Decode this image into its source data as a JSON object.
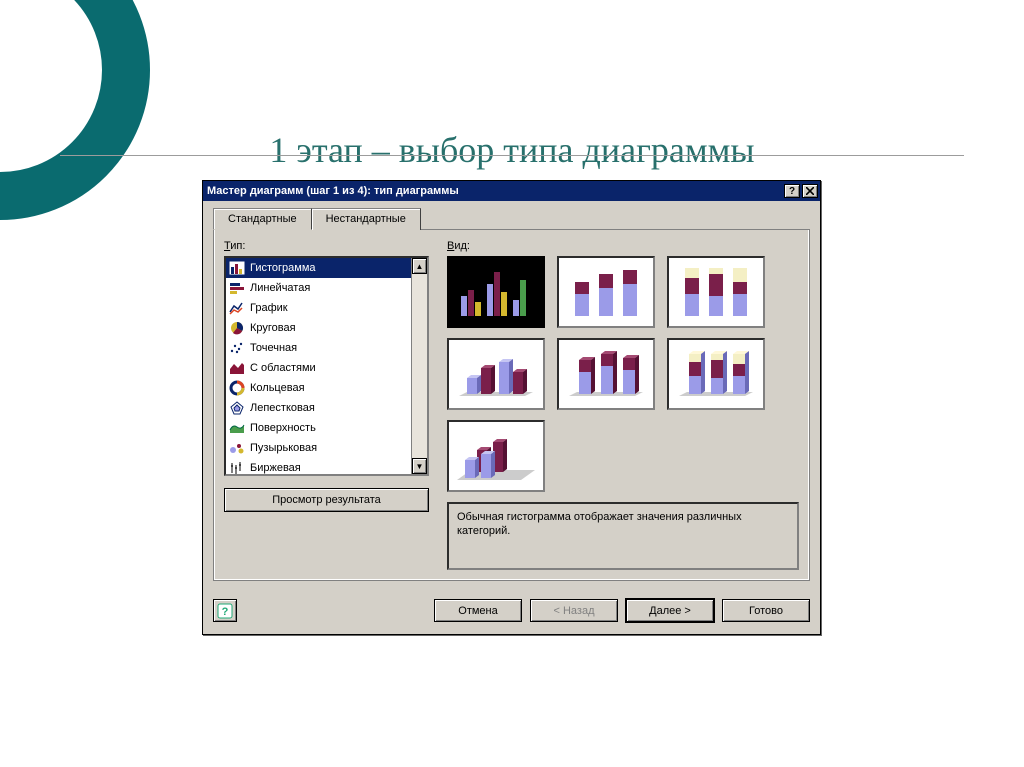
{
  "slide": {
    "title": "1 этап – выбор типа диаграммы"
  },
  "dialog": {
    "title": "Мастер диаграмм (шаг 1 из 4): тип диаграммы",
    "tabs": {
      "standard": "Стандартные",
      "custom": "Нестандартные"
    },
    "labels": {
      "type": "Тип:",
      "subtype": "Вид:"
    },
    "types": {
      "items": [
        {
          "label": "Гистограмма",
          "icon": "bar"
        },
        {
          "label": "Линейчатая",
          "icon": "hbar"
        },
        {
          "label": "График",
          "icon": "line"
        },
        {
          "label": "Круговая",
          "icon": "pie"
        },
        {
          "label": "Точечная",
          "icon": "scatter"
        },
        {
          "label": "С областями",
          "icon": "area"
        },
        {
          "label": "Кольцевая",
          "icon": "donut"
        },
        {
          "label": "Лепестковая",
          "icon": "radar"
        },
        {
          "label": "Поверхность",
          "icon": "surface"
        },
        {
          "label": "Пузырьковая",
          "icon": "bubble"
        },
        {
          "label": "Биржевая",
          "icon": "stock"
        }
      ],
      "selected_index": 0
    },
    "subtype_description": "Обычная гистограмма отображает значения различных категорий.",
    "preview_button": "Просмотр результата",
    "buttons": {
      "cancel": "Отмена",
      "back": "< Назад",
      "next": "Далее >",
      "finish": "Готово"
    },
    "colors": {
      "titlebar": "#0a246a",
      "face": "#d4d0c8",
      "accent_teal": "#0a6b6f",
      "chart_blue": "#9b9be8",
      "chart_maroon": "#7a1f4a",
      "chart_cream": "#f4efc4",
      "chart_green": "#4a9d4c",
      "chart_yellow": "#d4b82e"
    }
  }
}
